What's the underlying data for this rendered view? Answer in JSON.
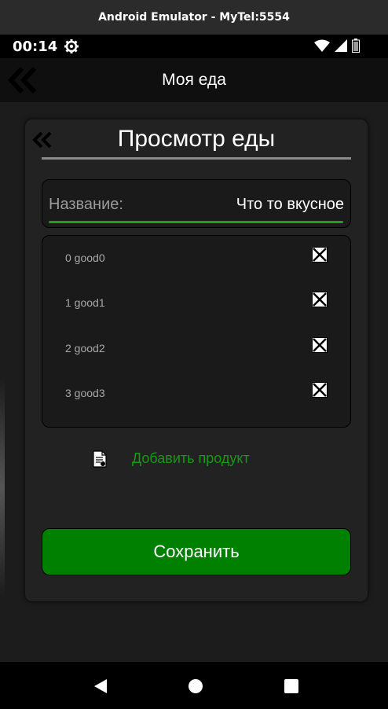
{
  "emulator": {
    "title": "Android Emulator - MyTel:5554"
  },
  "status_bar": {
    "time": "00:14"
  },
  "appbar": {
    "title": "Моя еда"
  },
  "dialog": {
    "title": "Просмотр еды",
    "name_field": {
      "label": "Название:",
      "value": "Что то вкусное"
    },
    "products": [
      {
        "label": "0 good0",
        "checked": true
      },
      {
        "label": "1 good1",
        "checked": true
      },
      {
        "label": "2 good2",
        "checked": true
      },
      {
        "label": "3 good3",
        "checked": true
      }
    ],
    "add_product_label": "Добавить продукт",
    "save_label": "Сохранить"
  },
  "colors": {
    "accent_green": "#008000",
    "underline_green": "#1aa31a",
    "link_green": "#159915",
    "background": "#1c1c1c"
  },
  "icons": {
    "back": "double-chevron-left-icon",
    "settings": "gear-icon",
    "wifi": "wifi-icon",
    "signal": "signal-icon",
    "battery": "battery-icon",
    "add_product": "document-icon",
    "checkbox": "checkbox-x-icon",
    "nav_back": "triangle-back-icon",
    "nav_home": "circle-home-icon",
    "nav_recents": "square-recents-icon"
  }
}
